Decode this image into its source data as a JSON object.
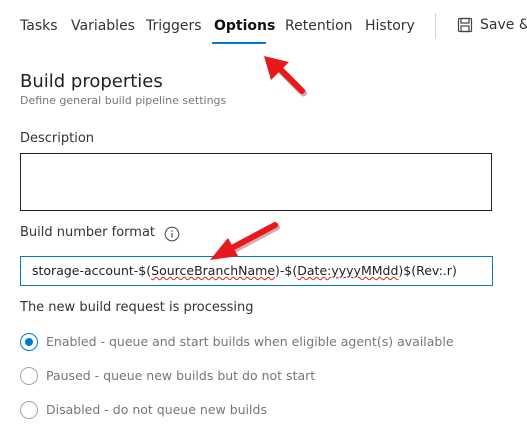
{
  "tabs": [
    {
      "label": "Tasks",
      "active": false
    },
    {
      "label": "Variables",
      "active": false
    },
    {
      "label": "Triggers",
      "active": false
    },
    {
      "label": "Options",
      "active": true
    },
    {
      "label": "Retention",
      "active": false
    },
    {
      "label": "History",
      "active": false
    }
  ],
  "toolbar": {
    "save_label": "Save &",
    "save_icon": "save-icon"
  },
  "build_properties": {
    "title": "Build properties",
    "subtitle": "Define general build pipeline settings"
  },
  "description": {
    "label": "Description",
    "value": ""
  },
  "build_number_format": {
    "label": "Build number format",
    "info_icon": "info-icon",
    "value_parts": [
      {
        "text": "storage-account-$(",
        "squiggle": false
      },
      {
        "text": "SourceBranchName",
        "squiggle": true
      },
      {
        "text": ")-$(",
        "squiggle": false
      },
      {
        "text": "Date:yyyyMMdd",
        "squiggle": true
      },
      {
        "text": ")$(Rev:.r)",
        "squiggle": false
      }
    ]
  },
  "processing": {
    "label": "The new build request is processing",
    "options": [
      {
        "label": "Enabled - queue and start builds when eligible agent(s) available",
        "checked": true
      },
      {
        "label": "Paused - queue new builds but do not start",
        "checked": false
      },
      {
        "label": "Disabled - do not queue new builds",
        "checked": false
      }
    ]
  },
  "colors": {
    "accent": "#0078d4",
    "annotation_arrow": "#e8191d",
    "muted_text": "#767676"
  }
}
